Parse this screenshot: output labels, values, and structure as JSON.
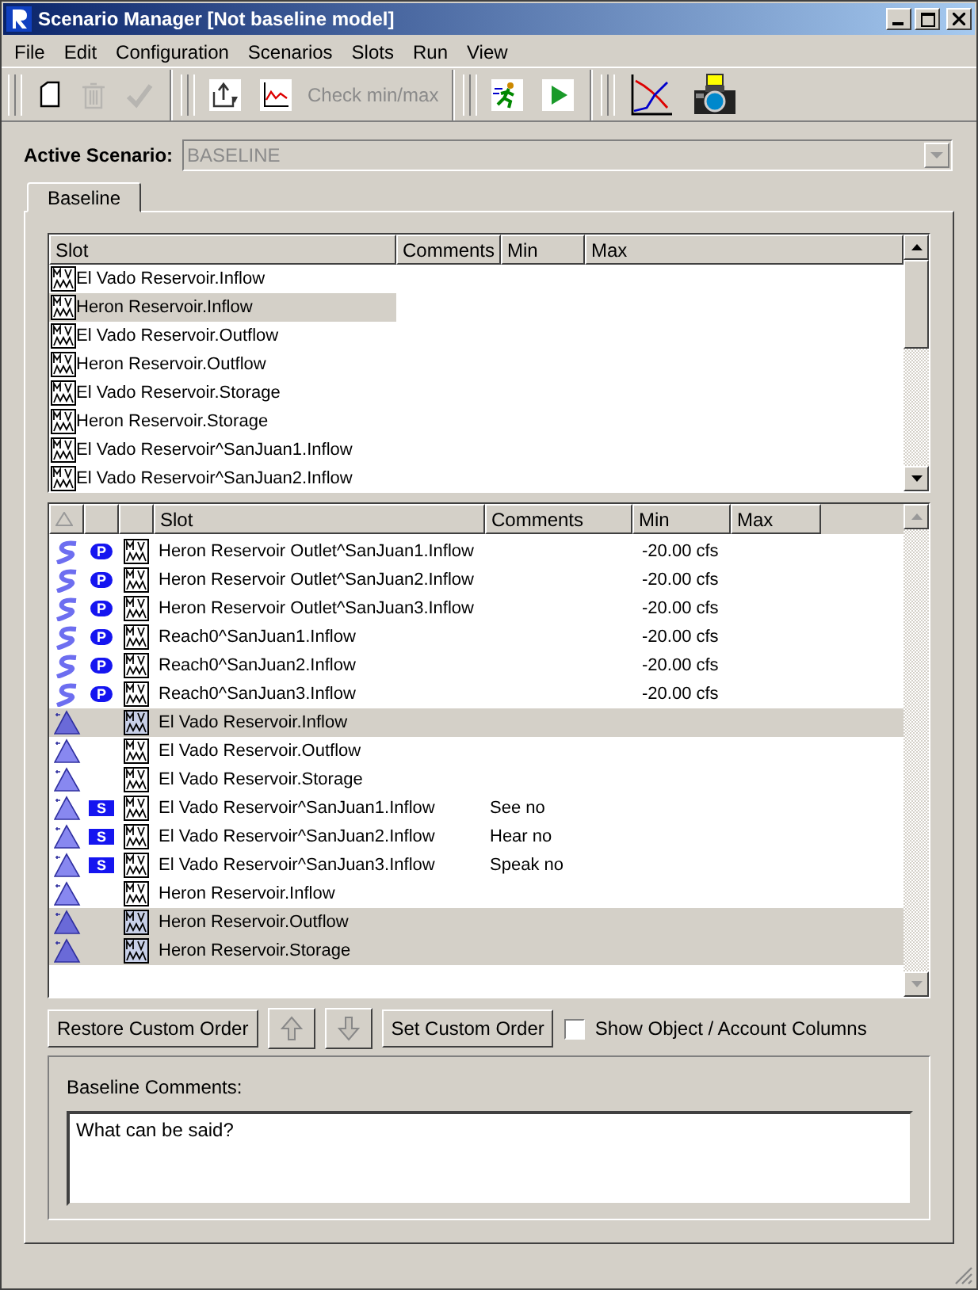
{
  "window": {
    "title": "Scenario Manager [Not baseline model]"
  },
  "menu": [
    "File",
    "Edit",
    "Configuration",
    "Scenarios",
    "Slots",
    "Run",
    "View"
  ],
  "toolbar": [
    {
      "kind": "new",
      "disabled": false
    },
    {
      "kind": "delete",
      "disabled": true
    },
    {
      "kind": "check",
      "disabled": true
    },
    {
      "kind": "sep"
    },
    {
      "kind": "export",
      "disabled": false
    },
    {
      "kind": "plot",
      "disabled": false
    },
    {
      "kind": "text",
      "label": "Check min/max",
      "disabled": true
    },
    {
      "kind": "sep"
    },
    {
      "kind": "runner",
      "disabled": false
    },
    {
      "kind": "play",
      "disabled": false
    },
    {
      "kind": "sep"
    },
    {
      "kind": "chart",
      "disabled": false
    },
    {
      "kind": "camera",
      "disabled": false
    }
  ],
  "active_scenario": {
    "label": "Active Scenario:",
    "value": "BASELINE",
    "disabled": true
  },
  "tabs": [
    {
      "label": "Baseline",
      "selected": true
    }
  ],
  "top_table": {
    "columns": [
      "Slot",
      "Comments",
      "Min",
      "Max"
    ],
    "rows": [
      {
        "slot": "El Vado Reservoir.Inflow",
        "selected": false
      },
      {
        "slot": "Heron Reservoir.Inflow",
        "selected": true
      },
      {
        "slot": "El Vado Reservoir.Outflow",
        "selected": false
      },
      {
        "slot": "Heron Reservoir.Outflow",
        "selected": false
      },
      {
        "slot": "El Vado Reservoir.Storage",
        "selected": false
      },
      {
        "slot": "Heron Reservoir.Storage",
        "selected": false
      },
      {
        "slot": "El Vado Reservoir^SanJuan1.Inflow",
        "selected": false
      },
      {
        "slot": "El Vado Reservoir^SanJuan2.Inflow",
        "selected": false
      }
    ]
  },
  "bottom_table": {
    "columns": [
      "Slot",
      "Comments",
      "Min",
      "Max"
    ],
    "rows": [
      {
        "kind": "reach",
        "badge": {
          "text": "P",
          "kind": "oval"
        },
        "slot": "Heron Reservoir Outlet^SanJuan1.Inflow",
        "min": "-20.00 cfs",
        "selected": false
      },
      {
        "kind": "reach",
        "badge": {
          "text": "P",
          "kind": "oval"
        },
        "slot": "Heron Reservoir Outlet^SanJuan2.Inflow",
        "min": "-20.00 cfs",
        "selected": false
      },
      {
        "kind": "reach",
        "badge": {
          "text": "P",
          "kind": "oval"
        },
        "slot": "Heron Reservoir Outlet^SanJuan3.Inflow",
        "min": "-20.00 cfs",
        "selected": false
      },
      {
        "kind": "reach",
        "badge": {
          "text": "P",
          "kind": "oval"
        },
        "slot": "Reach0^SanJuan1.Inflow",
        "min": "-20.00 cfs",
        "selected": false
      },
      {
        "kind": "reach",
        "badge": {
          "text": "P",
          "kind": "oval"
        },
        "slot": "Reach0^SanJuan2.Inflow",
        "min": "-20.00 cfs",
        "selected": false
      },
      {
        "kind": "reach",
        "badge": {
          "text": "P",
          "kind": "oval"
        },
        "slot": "Reach0^SanJuan3.Inflow",
        "min": "-20.00 cfs",
        "selected": false
      },
      {
        "kind": "reservoir",
        "slot": "El Vado Reservoir.Inflow",
        "selected": true
      },
      {
        "kind": "reservoir",
        "slot": "El Vado Reservoir.Outflow",
        "selected": false
      },
      {
        "kind": "reservoir",
        "slot": "El Vado Reservoir.Storage",
        "selected": false
      },
      {
        "kind": "reservoir",
        "badge": {
          "text": "S",
          "kind": "square"
        },
        "slot": "El Vado Reservoir^SanJuan1.Inflow",
        "comments": "See no",
        "selected": false
      },
      {
        "kind": "reservoir",
        "badge": {
          "text": "S",
          "kind": "square"
        },
        "slot": "El Vado Reservoir^SanJuan2.Inflow",
        "comments": "Hear no",
        "selected": false
      },
      {
        "kind": "reservoir",
        "badge": {
          "text": "S",
          "kind": "square"
        },
        "slot": "El Vado Reservoir^SanJuan3.Inflow",
        "comments": "Speak no",
        "selected": false
      },
      {
        "kind": "reservoir",
        "slot": "Heron Reservoir.Inflow",
        "selected": false
      },
      {
        "kind": "reservoir",
        "slot": "Heron Reservoir.Outflow",
        "selected": true
      },
      {
        "kind": "reservoir",
        "slot": "Heron Reservoir.Storage",
        "selected": true
      }
    ]
  },
  "buttons": [
    {
      "kind": "text",
      "label": "Restore Custom Order",
      "disabled": false
    },
    {
      "kind": "up",
      "disabled": true
    },
    {
      "kind": "down",
      "disabled": true
    },
    {
      "kind": "text",
      "label": "Set Custom Order",
      "disabled": false
    }
  ],
  "show_columns": {
    "label": "Show Object / Account Columns",
    "checked": false
  },
  "comments": {
    "label": "Baseline Comments:",
    "value": "What can be said?"
  }
}
